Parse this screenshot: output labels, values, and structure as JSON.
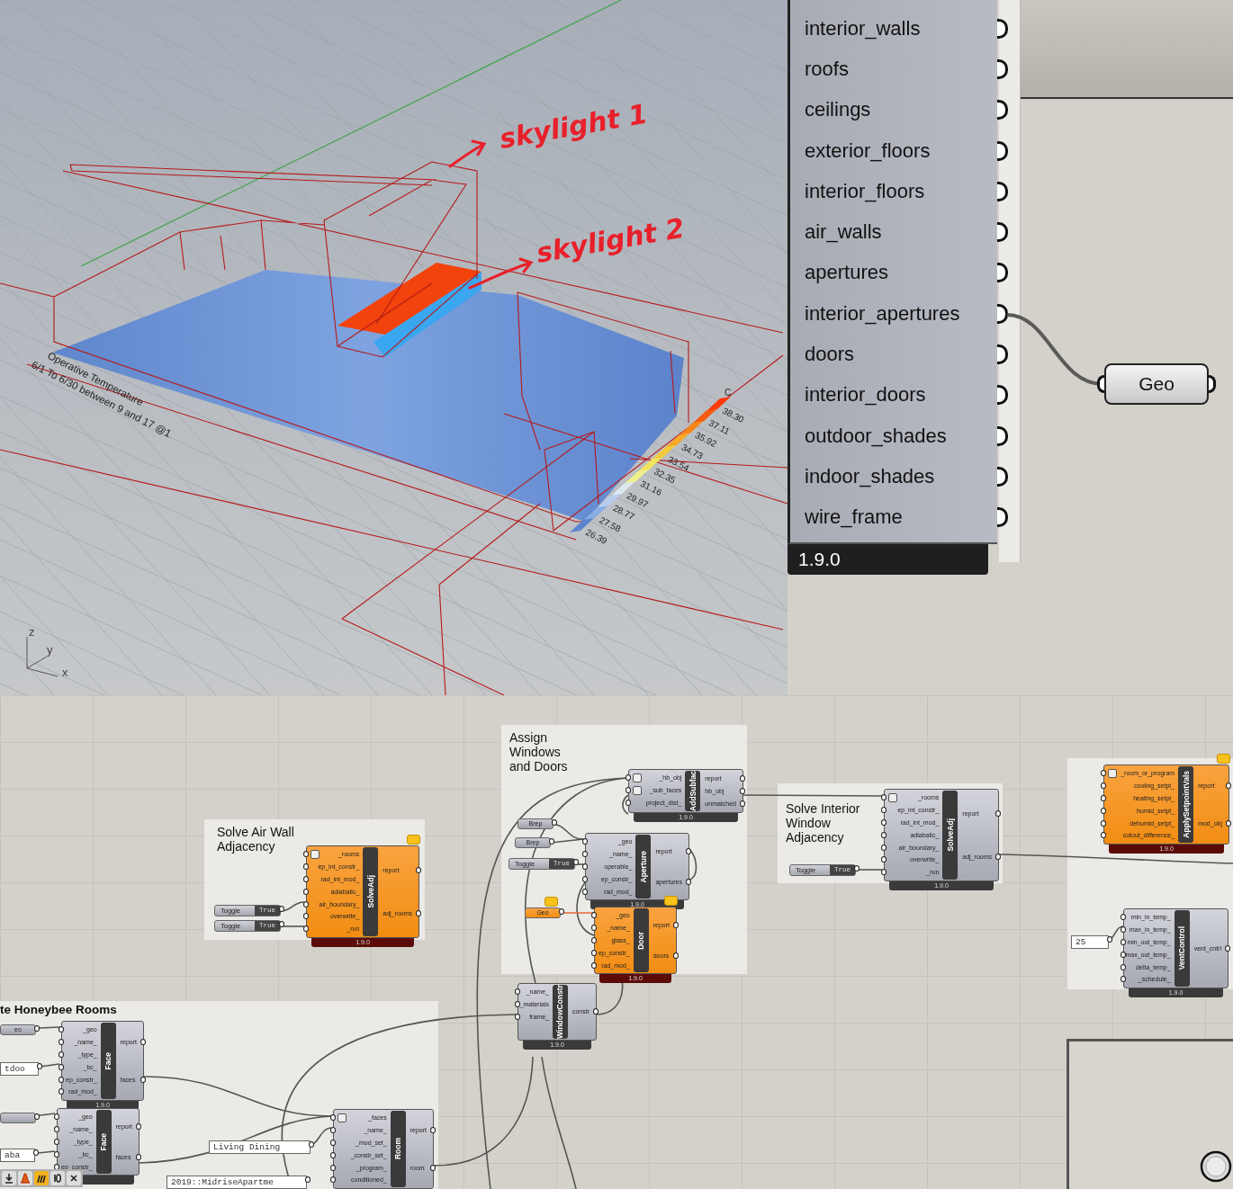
{
  "viewport": {
    "annotations": [
      {
        "text": "skylight 1"
      },
      {
        "text": "skylight 2"
      }
    ],
    "legend": {
      "title": "Operative Temperature",
      "subtitle": "6/1 To 6/30 between 9 and 17 @1",
      "unit": "C",
      "entries": [
        {
          "value": "38.30",
          "color": "#ff3a0a"
        },
        {
          "value": "37.11",
          "color": "#f85a12"
        },
        {
          "value": "35.92",
          "color": "#f7861a"
        },
        {
          "value": "34.73",
          "color": "#f8a826"
        },
        {
          "value": "33.54",
          "color": "#f5c93c"
        },
        {
          "value": "32.35",
          "color": "#f2e460"
        },
        {
          "value": "31.16",
          "color": "#eef08c"
        },
        {
          "value": "29.97",
          "color": "#dde7ef"
        },
        {
          "value": "28.77",
          "color": "#b6cdef"
        },
        {
          "value": "27.58",
          "color": "#88ace4"
        },
        {
          "value": "26.39",
          "color": "#5b84d0"
        }
      ]
    },
    "axes": [
      "z",
      "y",
      "x"
    ]
  },
  "zoomed_component": {
    "outputs": [
      "interior_walls",
      "roofs",
      "ceilings",
      "exterior_floors",
      "interior_floors",
      "air_walls",
      "apertures",
      "interior_apertures",
      "doors",
      "interior_doors",
      "outdoor_shades",
      "indoor_shades",
      "wire_frame"
    ],
    "version": "1.9.0"
  },
  "geo_param": {
    "label": "Geo"
  },
  "canvas": {
    "groups": [
      {
        "title": "Solve Air Wall Adjacency"
      },
      {
        "title": "Assign Windows and Doors"
      },
      {
        "title": "Solve Interior Window Adjacency"
      },
      {
        "title": "te Honeybee Rooms"
      }
    ],
    "components": [
      {
        "name": "SolveAdj",
        "warning": true,
        "balloon": true,
        "inputs": [
          {
            "name": "_rooms",
            "flatten": true
          },
          {
            "name": "ep_int_constr_",
            "flatten": false
          },
          {
            "name": "rad_int_mod_",
            "flatten": false
          },
          {
            "name": "adiabatic_",
            "flatten": false
          },
          {
            "name": "air_boundary_",
            "flatten": false
          },
          {
            "name": "overwrite_",
            "flatten": false
          },
          {
            "name": "_run",
            "flatten": false
          }
        ],
        "outputs": [
          "report",
          "adj_rooms"
        ],
        "version": "1.9.0"
      },
      {
        "name": "AddSubfac",
        "warning": false,
        "balloon": false,
        "inputs": [
          {
            "name": "_hb_obj",
            "flatten": true
          },
          {
            "name": "_sub_faces",
            "flatten": true
          },
          {
            "name": "project_dist_",
            "flatten": false
          }
        ],
        "outputs": [
          "report",
          "hb_obj",
          "unmatched"
        ],
        "version": "1.9.0"
      },
      {
        "name": "Aperture",
        "warning": false,
        "balloon": false,
        "inputs": [
          {
            "name": "_geo",
            "flatten": false
          },
          {
            "name": "_name_",
            "flatten": false
          },
          {
            "name": "operable_",
            "flatten": false
          },
          {
            "name": "ep_constr_",
            "flatten": false
          },
          {
            "name": "rad_mod_",
            "flatten": false
          }
        ],
        "outputs": [
          "report",
          "apertures"
        ],
        "version": "1.9.0"
      },
      {
        "name": "Door",
        "warning": true,
        "balloon": true,
        "inputs": [
          {
            "name": "_geo",
            "flatten": false
          },
          {
            "name": "_name_",
            "flatten": false
          },
          {
            "name": "glass_",
            "flatten": false
          },
          {
            "name": "ep_constr_",
            "flatten": false
          },
          {
            "name": "rad_mod_",
            "flatten": false
          }
        ],
        "outputs": [
          "report",
          "doors"
        ],
        "version": "1.9.0"
      },
      {
        "name": "SolveAdj",
        "warning": false,
        "balloon": false,
        "inputs": [
          {
            "name": "_rooms",
            "flatten": true
          },
          {
            "name": "ep_int_constr_",
            "flatten": false
          },
          {
            "name": "rad_int_mod_",
            "flatten": false
          },
          {
            "name": "adiabatic_",
            "flatten": false
          },
          {
            "name": "air_boundary_",
            "flatten": false
          },
          {
            "name": "overwrite_",
            "flatten": false
          },
          {
            "name": "_run",
            "flatten": false
          }
        ],
        "outputs": [
          "report",
          "adj_rooms"
        ],
        "version": "1.9.0"
      },
      {
        "name": "ApplySetpointVals",
        "warning": true,
        "balloon": true,
        "inputs": [
          {
            "name": "_room_or_program",
            "flatten": true
          },
          {
            "name": "cooling_setpt_",
            "flatten": false
          },
          {
            "name": "heating_setpt_",
            "flatten": false
          },
          {
            "name": "humid_setpt_",
            "flatten": false
          },
          {
            "name": "dehumid_setpt_",
            "flatten": false
          },
          {
            "name": "cutout_difference_",
            "flatten": false
          }
        ],
        "outputs": [
          "report",
          "mod_obj"
        ],
        "version": "1.9.0"
      },
      {
        "name": "VentControl",
        "warning": false,
        "balloon": false,
        "inputs": [
          {
            "name": "min_in_temp_",
            "flatten": false
          },
          {
            "name": "max_in_temp_",
            "flatten": false
          },
          {
            "name": "min_out_temp_",
            "flatten": false
          },
          {
            "name": "max_out_temp_",
            "flatten": false
          },
          {
            "name": "delta_temp_",
            "flatten": false
          },
          {
            "name": "_schedule_",
            "flatten": false
          }
        ],
        "outputs": [
          "vent_cntrl"
        ],
        "version": "1.9.0"
      },
      {
        "name": "WindowConstr",
        "warning": false,
        "balloon": false,
        "inputs": [
          {
            "name": "_name_",
            "flatten": false
          },
          {
            "name": "_materials",
            "flatten": false
          },
          {
            "name": "frame_",
            "flatten": false
          }
        ],
        "outputs": [
          "constr"
        ],
        "version": "1.9.0"
      },
      {
        "name": "Face",
        "warning": false,
        "balloon": false,
        "inputs": [
          {
            "name": "_geo",
            "flatten": false
          },
          {
            "name": "_name_",
            "flatten": false
          },
          {
            "name": "_type_",
            "flatten": false
          },
          {
            "name": "_bc_",
            "flatten": false
          },
          {
            "name": "ep_constr_",
            "flatten": false
          },
          {
            "name": "rad_mod_",
            "flatten": false
          }
        ],
        "outputs": [
          "report",
          "faces"
        ],
        "version": "1.9.0"
      },
      {
        "name": "Face",
        "warning": false,
        "balloon": false,
        "inputs": [
          {
            "name": "_geo",
            "flatten": false
          },
          {
            "name": "_name_",
            "flatten": false
          },
          {
            "name": "_type_",
            "flatten": false
          },
          {
            "name": "_bc_",
            "flatten": false
          },
          {
            "name": "ep_constr_",
            "flatten": false
          }
        ],
        "outputs": [
          "report",
          "faces"
        ]
      },
      {
        "name": "Room",
        "warning": false,
        "balloon": false,
        "inputs": [
          {
            "name": "_faces",
            "flatten": true
          },
          {
            "name": "_name_",
            "flatten": false
          },
          {
            "name": "_mod_set_",
            "flatten": false
          },
          {
            "name": "_constr_set_",
            "flatten": false
          },
          {
            "name": "_program_",
            "flatten": false
          },
          {
            "name": "conditioned_",
            "flatten": false
          }
        ],
        "outputs": [
          "report",
          "room"
        ]
      }
    ],
    "toggles": [
      {
        "label": "Toggle",
        "value": "True"
      },
      {
        "label": "Toggle",
        "value": "True"
      },
      {
        "label": "Toggle",
        "value": "True"
      },
      {
        "label": "Toggle",
        "value": "True"
      }
    ],
    "params": [
      {
        "label": "Brep",
        "warning": false,
        "balloon": false
      },
      {
        "label": "Brep",
        "warning": false,
        "balloon": false
      },
      {
        "label": "Geo",
        "warning": true,
        "balloon": true
      },
      {
        "label": "eo",
        "warning": false,
        "balloon": false
      },
      {
        "warning": false,
        "balloon": false
      }
    ],
    "panels": [
      {
        "text": "25"
      },
      {
        "text": "tdoo"
      },
      {
        "text": "aba"
      },
      {
        "text": "Living Dining"
      },
      {
        "text": "2019::MidriseApartme"
      }
    ]
  }
}
